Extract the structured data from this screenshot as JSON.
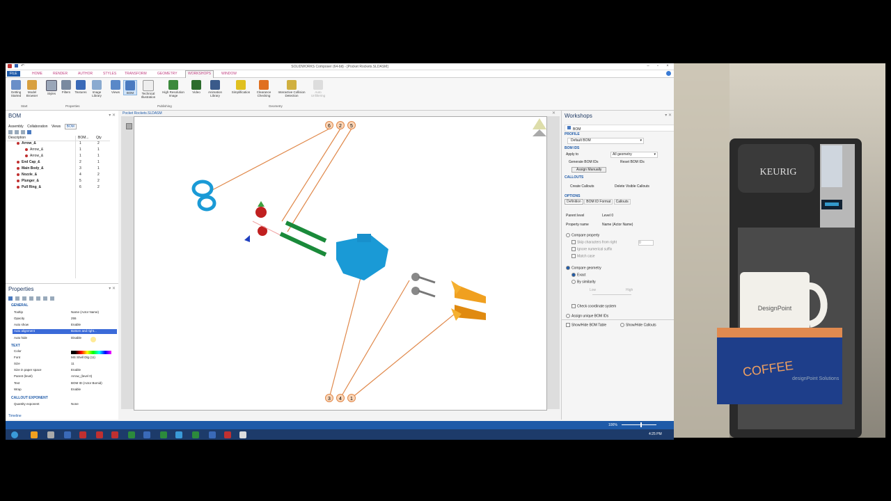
{
  "window": {
    "title": "SOLIDWORKS Composer (64-bit) - [Pocket Rockets.SLDASM]"
  },
  "ribbon_tabs": [
    {
      "label": "FILE"
    },
    {
      "label": "HOME"
    },
    {
      "label": "RENDER"
    },
    {
      "label": "AUTHOR"
    },
    {
      "label": "STYLES"
    },
    {
      "label": "TRANSFORM"
    },
    {
      "label": "GEOMETRY"
    },
    {
      "label": "WORKSHOPS"
    },
    {
      "label": "WINDOW"
    }
  ],
  "ribbon": {
    "buttons": [
      {
        "label": "Getting Started"
      },
      {
        "label": "Model Browser"
      },
      {
        "label": "Styles"
      },
      {
        "label": "Filters"
      },
      {
        "label": "Textures"
      },
      {
        "label": "Image Library"
      },
      {
        "label": "Views"
      },
      {
        "label": "BOM"
      },
      {
        "label": "Technical Illustration"
      },
      {
        "label": "High Resolution Image"
      },
      {
        "label": "Video"
      },
      {
        "label": "Animation Library"
      },
      {
        "label": "Simplification"
      },
      {
        "label": "Clearance Checking"
      },
      {
        "label": "Interactive Collision Detection"
      },
      {
        "label": "Auto Unfiltering"
      }
    ],
    "groups": [
      {
        "label": "Start"
      },
      {
        "label": "Properties"
      },
      {
        "label": "Publishing"
      },
      {
        "label": "Geometry"
      }
    ]
  },
  "bom_panel": {
    "title": "BOM",
    "tabs": [
      {
        "label": "Assembly"
      },
      {
        "label": "Collaboration"
      },
      {
        "label": "Views"
      },
      {
        "label": "BOM"
      }
    ],
    "columns": {
      "description": "Description",
      "bom": "BOM...",
      "qty": "Qty"
    },
    "rows": [
      {
        "description": "Arrow_&",
        "bom": "1",
        "qty": "2"
      },
      {
        "description": "Arrow_&",
        "bom": "1",
        "qty": "1"
      },
      {
        "description": "Arrow_&",
        "bom": "1",
        "qty": "1"
      },
      {
        "description": "End Cap_&",
        "bom": "2",
        "qty": "1"
      },
      {
        "description": "Main Body_&",
        "bom": "3",
        "qty": "1"
      },
      {
        "description": "Nozzle_&",
        "bom": "4",
        "qty": "2"
      },
      {
        "description": "Plunger_&",
        "bom": "5",
        "qty": "2"
      },
      {
        "description": "Pull Ring_&",
        "bom": "6",
        "qty": "2"
      }
    ]
  },
  "properties_panel": {
    "title": "Properties",
    "sections": {
      "general": "GENERAL",
      "text": "TEXT",
      "callout": "CALLOUT EXPONENT"
    },
    "rows": [
      {
        "k": "Tooltip",
        "v": "Name (Actor Name)"
      },
      {
        "k": "Opacity",
        "v": "255"
      },
      {
        "k": "Auto show",
        "v": "Enable"
      },
      {
        "k": "Auto alignment",
        "v": "Bottom and right..."
      },
      {
        "k": "Auto hide",
        "v": "Disable"
      },
      {
        "k": "Color",
        "v": ""
      },
      {
        "k": "Font",
        "v": "MS Shell Dlg (11)"
      },
      {
        "k": "Size",
        "v": "11"
      },
      {
        "k": "Size in paper space",
        "v": "Enable"
      },
      {
        "k": "Parent (level)",
        "v": "Arrow_(level 0)"
      },
      {
        "k": "Text",
        "v": "BOM ID (Actor Bomid)"
      },
      {
        "k": "Wrap",
        "v": "Enable"
      },
      {
        "k": "Quantity exponent",
        "v": "None"
      }
    ],
    "footer": "Timeline"
  },
  "viewport": {
    "tab": "Pocket Rockets.SLDASM",
    "callouts_top": [
      "6",
      "2",
      "5"
    ],
    "callouts_bottom": [
      "3",
      "4",
      "1"
    ]
  },
  "workshops_panel": {
    "title": "Workshops",
    "bom_label": "BOM",
    "profile_label": "PROFILE",
    "profile_value": "Default BOM",
    "bom_ids_label": "BOM IDS",
    "apply_to_label": "Apply to",
    "apply_to_value": "All geometry",
    "generate_btn": "Generate BOM IDs",
    "reset_btn": "Reset BOM IDs",
    "assign_btn": "Assign Manually",
    "callouts_label": "CALLOUTS",
    "create_callouts": "Create Callouts",
    "delete_callouts": "Delete Visible Callouts",
    "options_label": "OPTIONS",
    "option_tabs": [
      {
        "label": "Definition"
      },
      {
        "label": "BOM ID Format"
      },
      {
        "label": "Callouts"
      }
    ],
    "parent_level_label": "Parent level",
    "parent_level_value": "Level 0",
    "property_name_label": "Property name",
    "property_name_value": "Name (Actor Name)",
    "compare_property": "Compare property",
    "skip_chars": "Skip characters from right",
    "skip_value": "0",
    "ignore_suffix": "Ignore numerical suffix",
    "match_case": "Match case",
    "compare_geometry": "Compare geometry",
    "exact": "Exact",
    "by_similarity": "By similarity",
    "low": "Low",
    "high": "High",
    "check_coord": "Check coordinate system",
    "assign_unique": "Assign unique BOM IDs",
    "show_hide_table": "Show/Hide BOM Table",
    "show_hide_callouts": "Show/Hide Callouts"
  },
  "statusbar": {
    "zoom": "100%",
    "clock": "4:25 PM"
  },
  "photo": {
    "brand": "KEURIG",
    "mug_text": "DesignPoint",
    "box_text": "COFFEE",
    "box_sub": "designPoint Solutions"
  }
}
